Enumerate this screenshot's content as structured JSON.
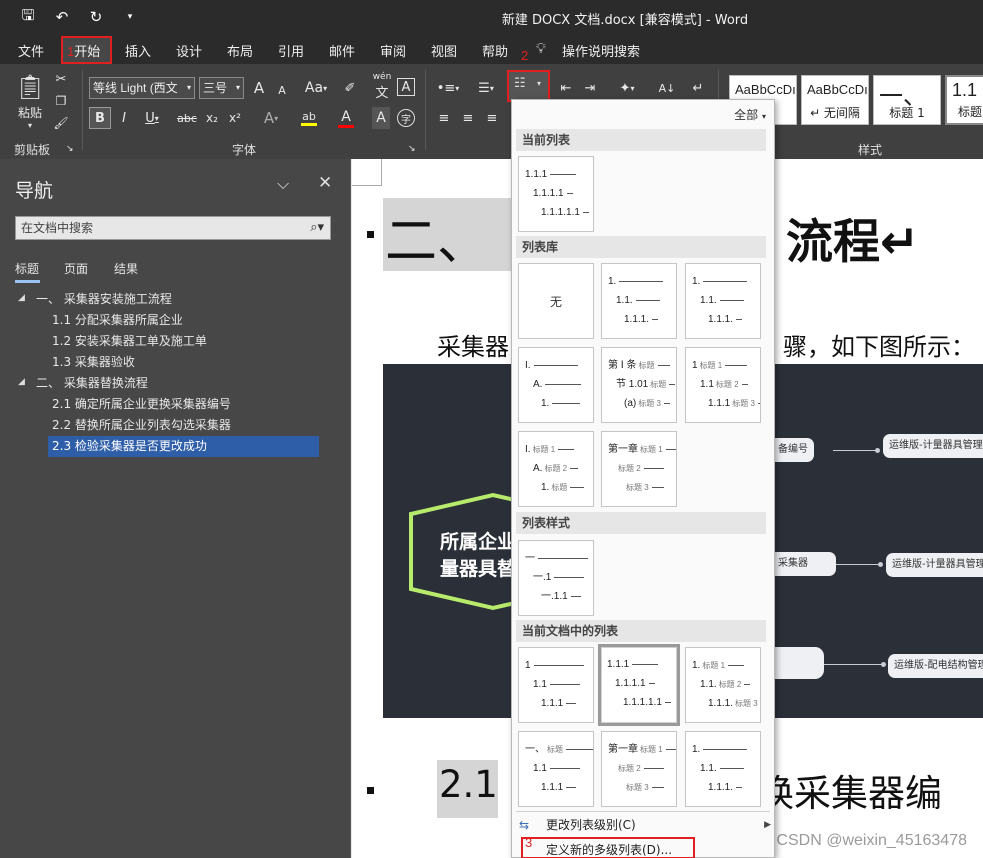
{
  "window": {
    "title": "新建 DOCX 文档.docx [兼容模式]  -  Word"
  },
  "ribbon_tabs": [
    "文件",
    "开始",
    "插入",
    "设计",
    "布局",
    "引用",
    "邮件",
    "审阅",
    "视图",
    "帮助",
    "操作说明搜索"
  ],
  "annotations": {
    "step1": "1",
    "step2": "2",
    "step3": "3"
  },
  "clipboard": {
    "paste_label": "粘贴",
    "group_label": "剪贴板"
  },
  "font": {
    "family": "等线 Light (西文",
    "size": "三号",
    "group_label": "字体",
    "grow": "A",
    "shrink": "A",
    "case": "Aa",
    "phonetic": "wén",
    "border_char": "A",
    "bold": "B",
    "italic": "I",
    "underline": "U",
    "strike": "abc",
    "subscript": "x₂",
    "superscript": "x²",
    "effects": "A",
    "highlight": "ab",
    "font_color": "A",
    "shading": "A",
    "enclose": "字"
  },
  "styles": {
    "group_label": "样式",
    "items": [
      {
        "preview": "AaBbCcDı",
        "name": ""
      },
      {
        "preview": "AaBbCcDı",
        "name": "↵ 无间隔"
      },
      {
        "preview": "一、",
        "name": "标题 1"
      },
      {
        "preview": "1.1",
        "name": "标题"
      }
    ]
  },
  "navigation": {
    "title": "导航",
    "search_placeholder": "在文档中搜索",
    "tabs": [
      "标题",
      "页面",
      "结果"
    ],
    "tree": [
      {
        "label": "一、 采集器安装施工流程",
        "level": 1
      },
      {
        "label": "1.1 分配采集器所属企业",
        "level": 2
      },
      {
        "label": "1.2 安装采集器工单及施工单",
        "level": 2
      },
      {
        "label": "1.3 采集器验收",
        "level": 2
      },
      {
        "label": "二、 采集器替换流程",
        "level": 1
      },
      {
        "label": "2.1 确定所属企业更换采集器编号",
        "level": 2
      },
      {
        "label": "2.2 替换所属企业列表勾选采集器",
        "level": 2
      },
      {
        "label": "2.3 检验采集器是否更改成功",
        "level": 2,
        "selected": true
      }
    ]
  },
  "document": {
    "heading1_left": "二、",
    "heading1_right": "流程↵",
    "para_left": "采集器",
    "para_right": "骤，如下图所示：",
    "diagram": {
      "center_line1": "所属企业",
      "center_line2": "量器具替",
      "nodes": [
        "备编号",
        "运维版-计量器具管理-",
        "采集器",
        "运维版-计量器具管理-",
        "运维版-配电结构管理-"
      ]
    },
    "heading2_left": "2.1",
    "heading2_right": "换采集器编",
    "watermark": "CSDN @weixin_45163478"
  },
  "gallery": {
    "filter": "全部",
    "sections": {
      "current": "当前列表",
      "library": "列表库",
      "styles": "列表样式",
      "in_document": "当前文档中的列表"
    },
    "none_label": "无",
    "menu": [
      {
        "label": "更改列表级别(C)",
        "icon": "indent-icon"
      },
      {
        "label": "定义新的多级列表(D)...",
        "icon": ""
      }
    ]
  },
  "cells": {
    "current": [
      [
        "1.1.1",
        "1.1.1.1",
        "1.1.1.1.1"
      ]
    ],
    "library": [
      [
        [
          "1.",
          ""
        ],
        [
          "1.1.",
          ""
        ],
        [
          "1.1.1.",
          ""
        ]
      ],
      [
        [
          "1.",
          ""
        ],
        [
          "1.1.",
          ""
        ],
        [
          "1.1.1.",
          ""
        ]
      ],
      [
        [
          "I.",
          ""
        ],
        [
          "A.",
          ""
        ],
        [
          "1.",
          ""
        ]
      ],
      [
        [
          "第 Ⅰ 条",
          "标题"
        ],
        [
          "节 1.01",
          "标题"
        ],
        [
          "(a)",
          "标题 3"
        ]
      ],
      [
        [
          "1",
          "标题 1"
        ],
        [
          "1.1",
          "标题 2"
        ],
        [
          "1.1.1",
          "标题 3"
        ]
      ],
      [
        [
          "I.",
          "标题 1"
        ],
        [
          "A.",
          "标题 2"
        ],
        [
          "1.",
          "标题"
        ]
      ],
      [
        [
          "第一章",
          "标题 1"
        ],
        [
          "",
          "标题 2"
        ],
        [
          "",
          "标题 3"
        ]
      ]
    ],
    "list_styles": [
      [
        [
          "一",
          ""
        ],
        [
          "一.1",
          ""
        ],
        [
          "一.1.1",
          ""
        ]
      ]
    ],
    "in_document": [
      [
        [
          "1",
          ""
        ],
        [
          "1.1",
          ""
        ],
        [
          "1.1.1",
          ""
        ]
      ],
      [
        [
          "1.1.1",
          ""
        ],
        [
          "1.1.1.1",
          ""
        ],
        [
          "1.1.1.1.1",
          ""
        ]
      ],
      [
        [
          "1.",
          "标题 1"
        ],
        [
          "1.1.",
          "标题 2"
        ],
        [
          "1.1.1.",
          "标题 3"
        ]
      ],
      [
        [
          "一、",
          "标题"
        ],
        [
          "1.1",
          ""
        ],
        [
          "1.1.1",
          ""
        ]
      ],
      [
        [
          "第一章",
          "标题 1"
        ],
        [
          "",
          "标题 2"
        ],
        [
          "",
          "标题 3"
        ]
      ],
      [
        [
          "1.",
          ""
        ],
        [
          "1.1.",
          ""
        ],
        [
          "1.1.1.",
          ""
        ]
      ]
    ]
  }
}
